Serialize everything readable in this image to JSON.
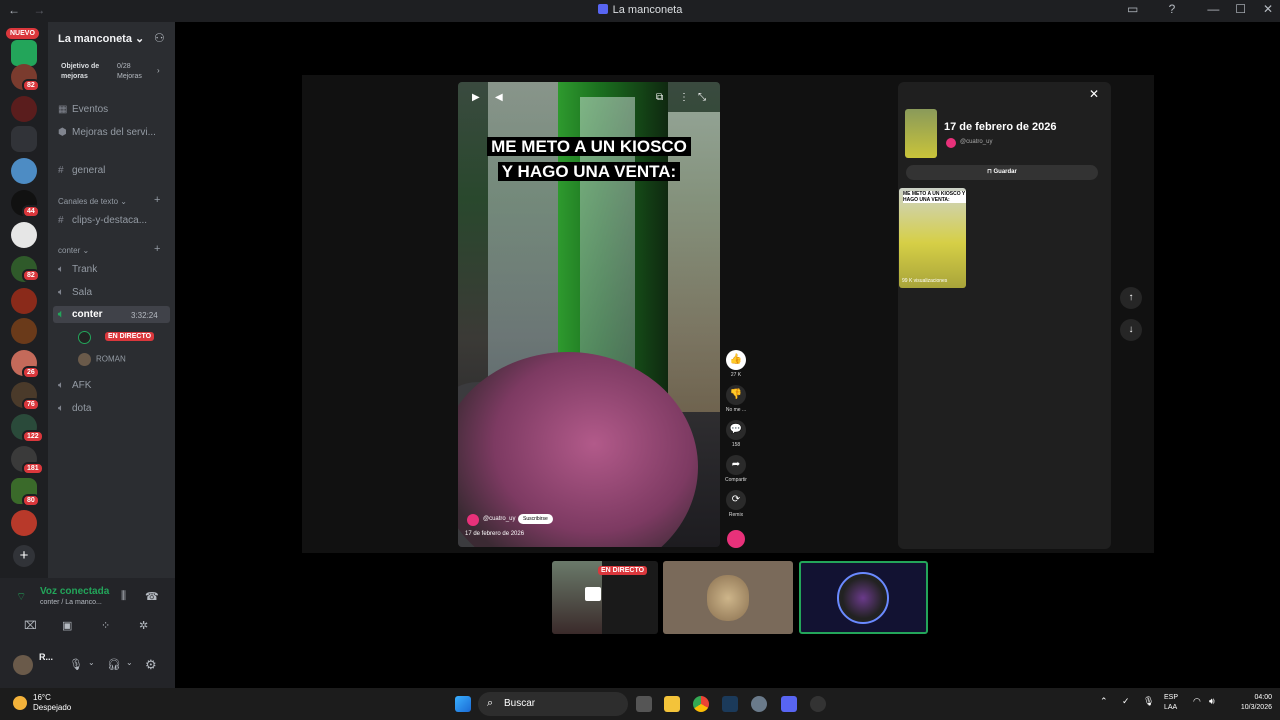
{
  "window": {
    "title": "La manconeta",
    "back": "←",
    "forward": "→",
    "controls": [
      "▭",
      "?",
      "—",
      "☐",
      "✕"
    ]
  },
  "guilds": {
    "nuevo_label": "NUEVO",
    "badges": [
      "82",
      "44",
      "82",
      "26",
      "76",
      "122",
      "181",
      "80"
    ],
    "add_label": "+"
  },
  "server": {
    "name": "La manconeta",
    "boost_title": "Objetivo de mejoras",
    "boost_count": "0/28",
    "boost_unit": "Mejoras",
    "events": "Eventos",
    "upgrades": "Mejoras del servi...",
    "general": "general",
    "text_category": "Canales de texto",
    "clips": "clips-y-destaca...",
    "voice_category": "conter",
    "voice_channels": [
      "Trank",
      "Sala",
      "conter",
      "AFK",
      "dota"
    ],
    "active_timer": "3:32:24",
    "live_label": "EN DIRECTO",
    "member_roman": "ROMAN"
  },
  "voice_panel": {
    "status": "Voz conectada",
    "location": "conter / La manco...",
    "user_short": "R..."
  },
  "video": {
    "caption_line1": "ME METO A UN KIOSCO",
    "caption_line2": "Y  HAGO UNA VENTA:",
    "handle": "@cuatro_uy",
    "subscribe": "Suscribirse",
    "date": "17 de febrero de 2026",
    "actions": [
      {
        "icon": "👍",
        "label": "27 K"
      },
      {
        "icon": "👎",
        "label": "No me ..."
      },
      {
        "icon": "💬",
        "label": "158"
      },
      {
        "icon": "➦",
        "label": "Compartir"
      },
      {
        "icon": "⟳",
        "label": "Remix"
      }
    ]
  },
  "info_panel": {
    "close": "✕",
    "date": "17 de febrero de 2026",
    "handle": "@cuatro_uy",
    "save": "Guardar",
    "card_title": "ME METO A UN KIOSCO Y HAGO UNA VENTA:",
    "card_views": "99 K visualizaciones",
    "up": "↑",
    "down": "↓"
  },
  "stream_tiles": {
    "live_label": "EN DIRECTO"
  },
  "taskbar": {
    "temp": "16°C",
    "weather": "Despejado",
    "search": "Buscar",
    "lang1": "ESP",
    "lang2": "LAA",
    "time": "04:00",
    "date": "10/3/2026"
  }
}
